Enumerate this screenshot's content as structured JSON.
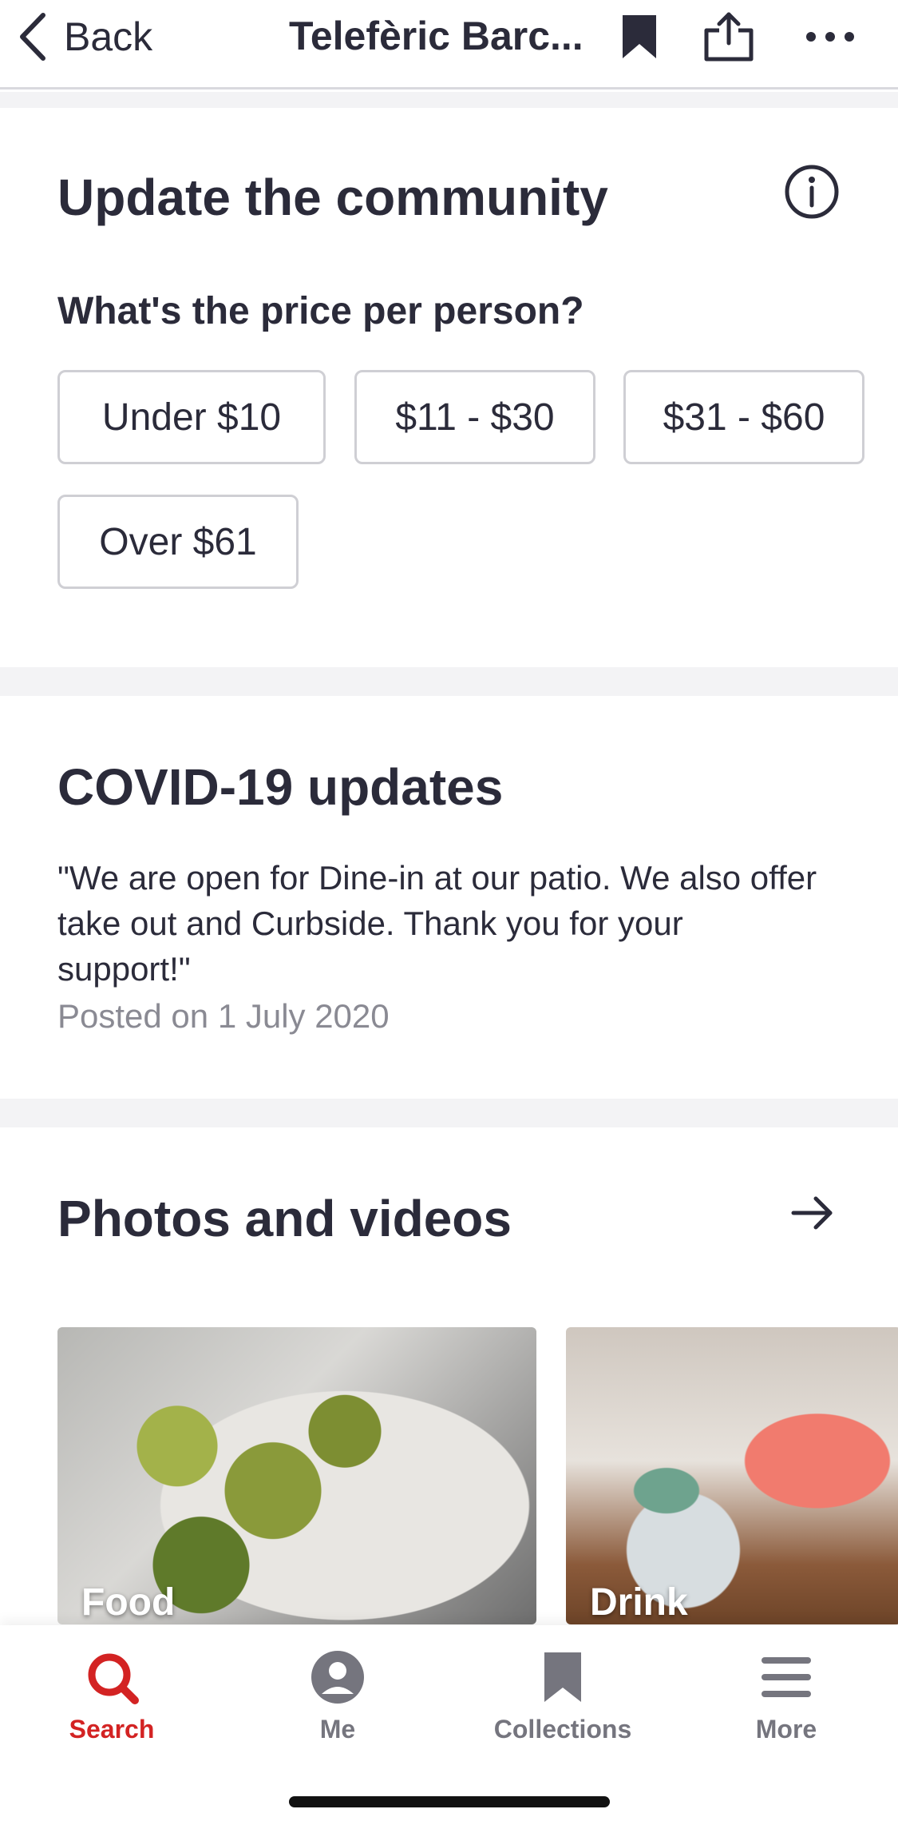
{
  "nav": {
    "back_label": "Back",
    "title": "Telefèric Barc...",
    "icons": [
      "bookmark-icon",
      "share-icon",
      "more-icon"
    ]
  },
  "community": {
    "heading": "Update the community",
    "question": "What's the price per person?",
    "price_options": [
      "Under $10",
      "$11 - $30",
      "$31 - $60",
      "Over $61"
    ]
  },
  "covid": {
    "heading": "COVID-19 updates",
    "message": "\"We are open for Dine-in at our patio. We also offer take out and Curbside. Thank you for your support!\"",
    "posted": "Posted on 1 July 2020"
  },
  "photos": {
    "heading": "Photos and videos",
    "cards": [
      {
        "label": "Food"
      },
      {
        "label": "Drink"
      }
    ]
  },
  "tabbar": {
    "items": [
      {
        "label": "Search",
        "icon": "search-icon",
        "active": true
      },
      {
        "label": "Me",
        "icon": "profile-icon",
        "active": false
      },
      {
        "label": "Collections",
        "icon": "bookmark-icon",
        "active": false
      },
      {
        "label": "More",
        "icon": "menu-icon",
        "active": false
      }
    ]
  },
  "colors": {
    "accent": "#d32323",
    "text": "#2b2b3a",
    "muted": "#8a8a93",
    "separator": "#f3f3f5"
  }
}
